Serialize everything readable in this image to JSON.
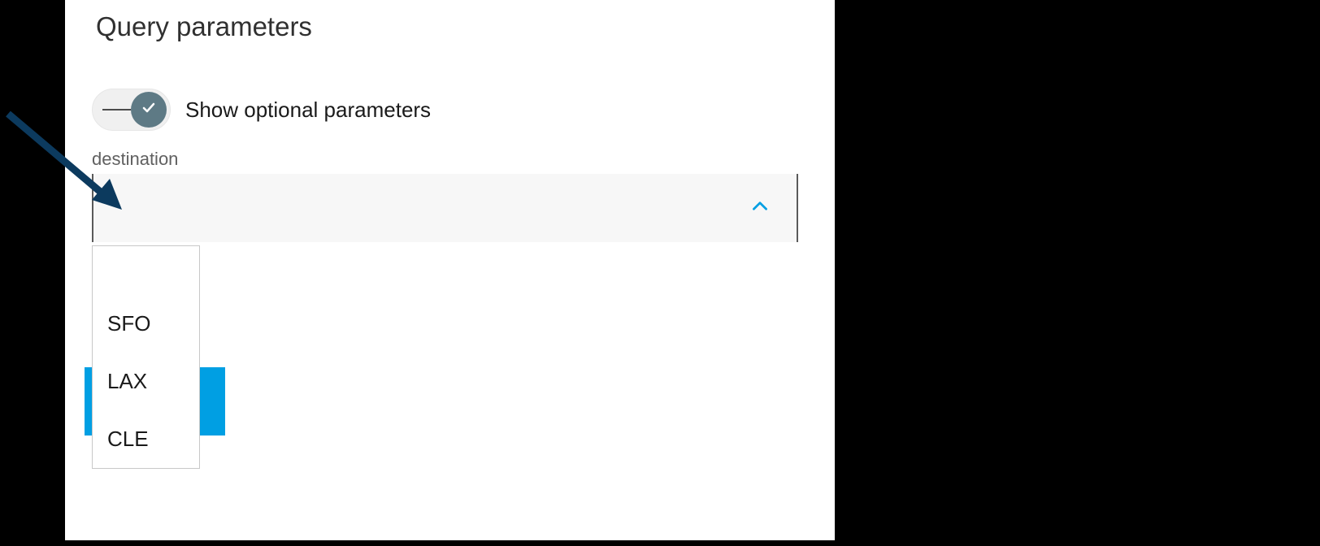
{
  "heading": "Query parameters",
  "toggle": {
    "label": "Show optional parameters",
    "state": "on"
  },
  "field": {
    "label": "destination",
    "value": "",
    "options": [
      "SFO",
      "LAX",
      "CLE"
    ]
  },
  "colors": {
    "accent": "#009fe3",
    "toggle_knob": "#5e7a85",
    "arrow": "#0c3a5e"
  }
}
